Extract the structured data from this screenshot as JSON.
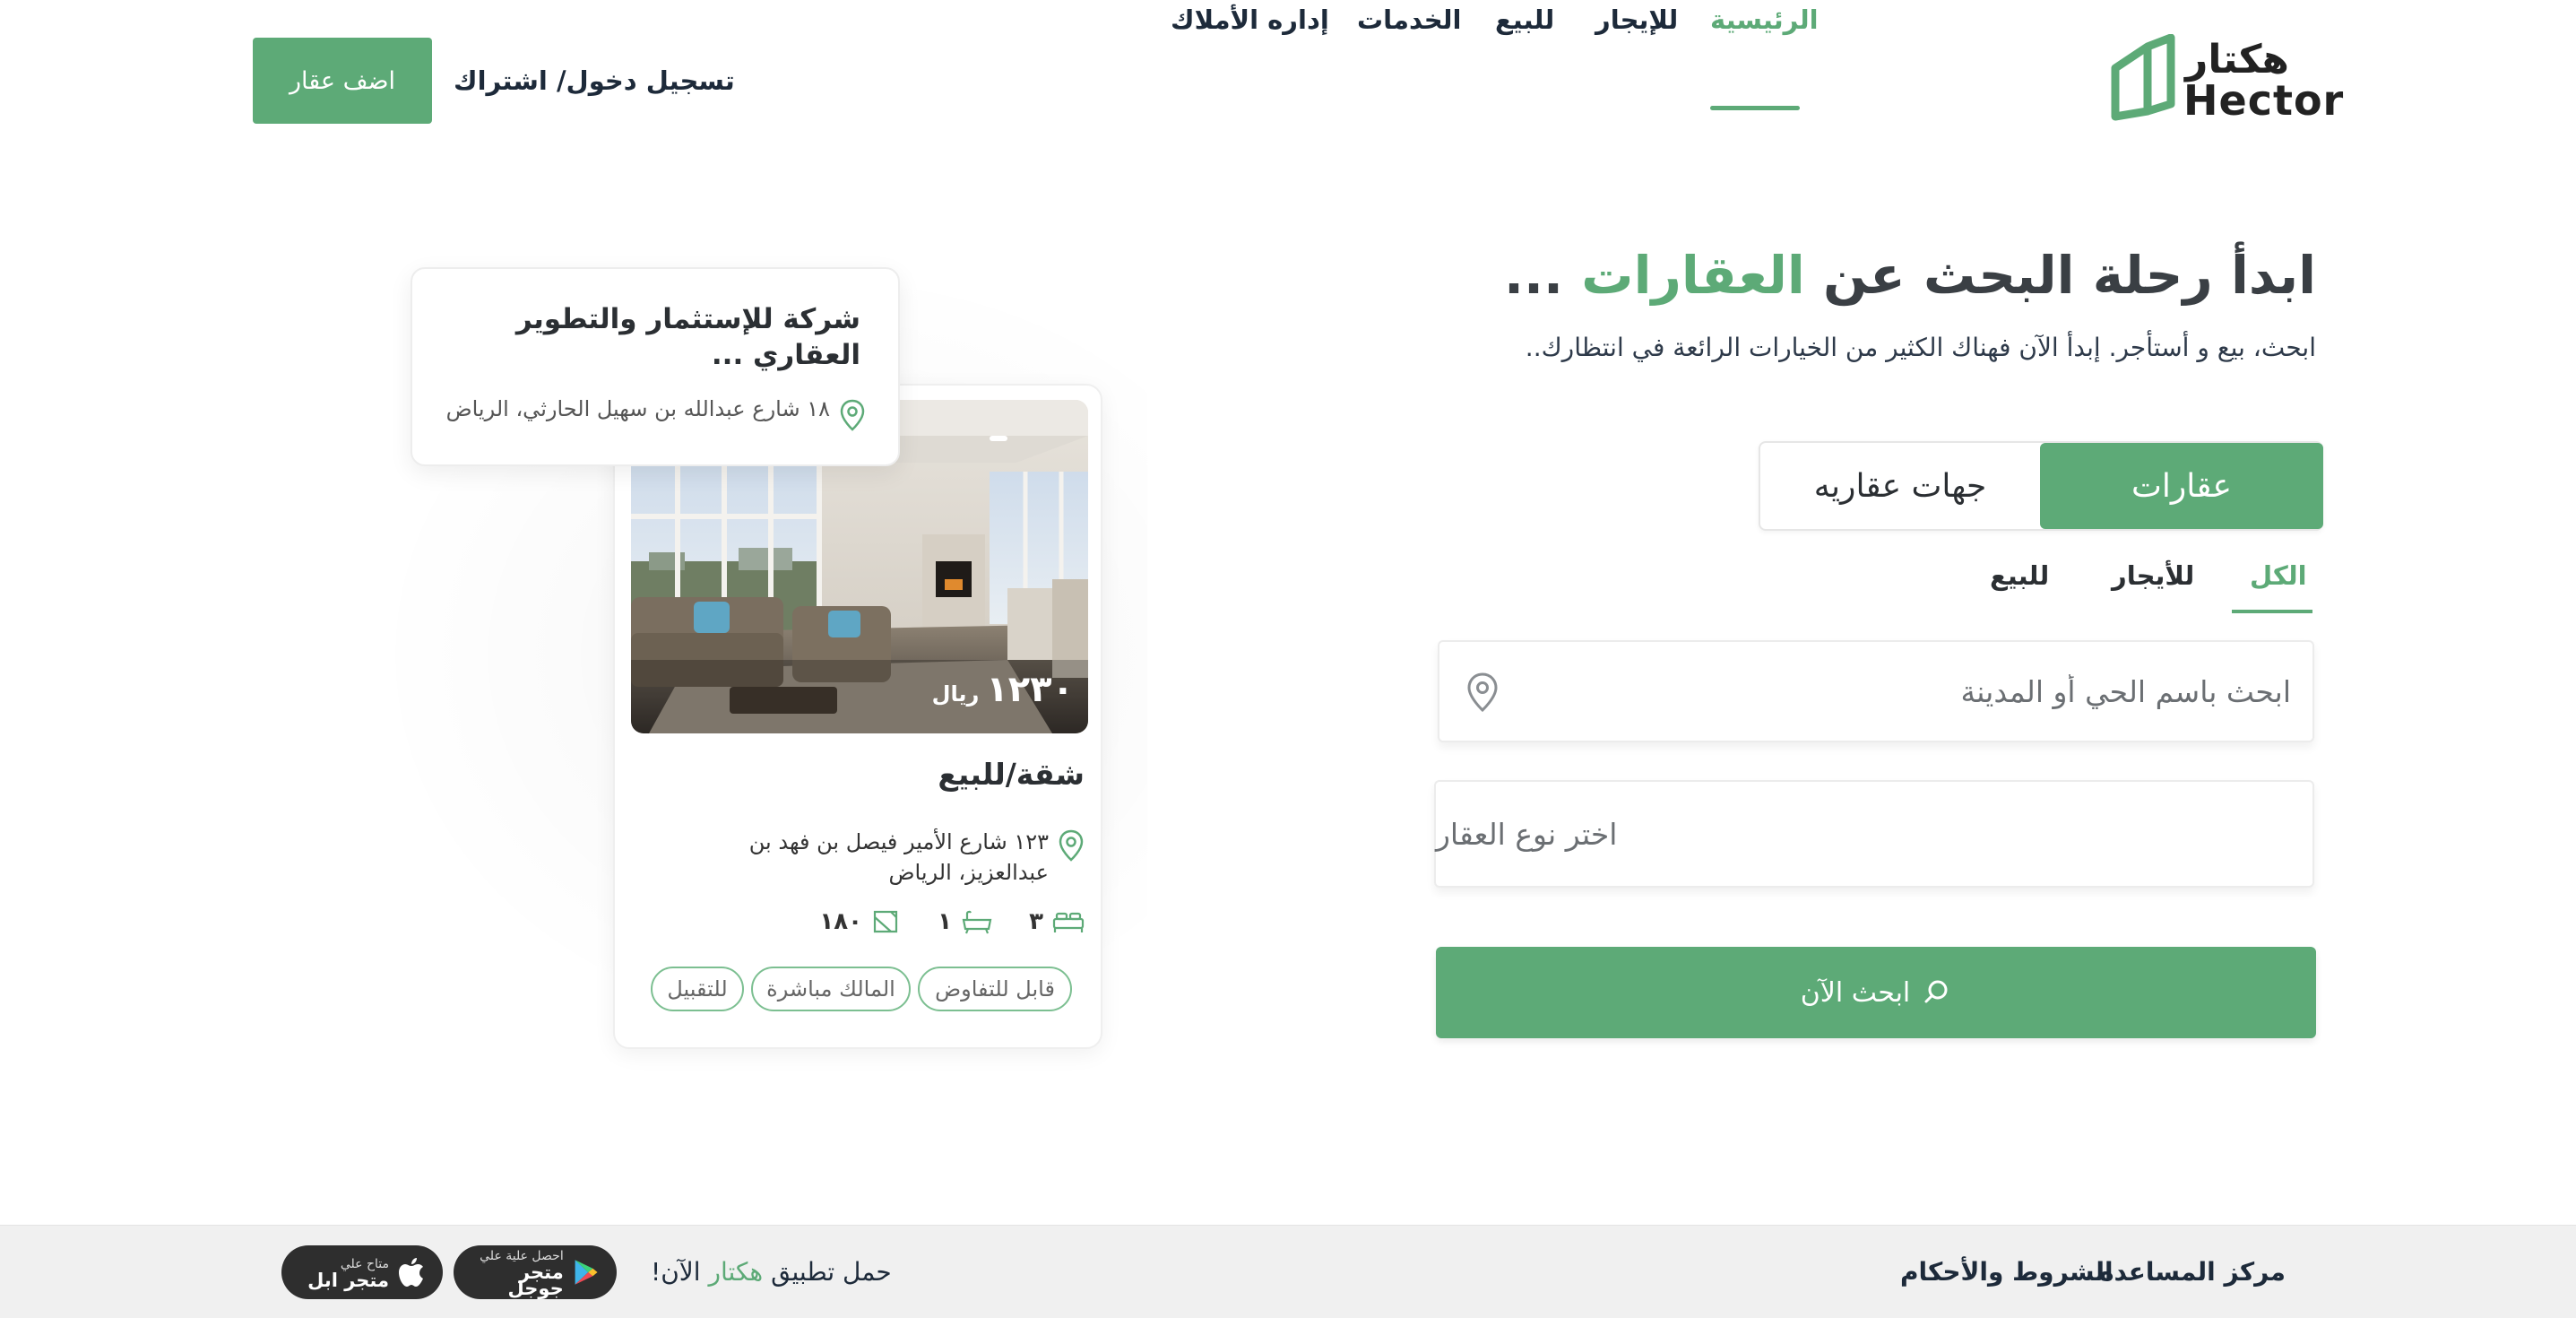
{
  "brand": {
    "name_ar": "هكتار",
    "name_en": "Hector",
    "color": "#5daa77"
  },
  "nav": {
    "home": "الرئيسية",
    "rent": "للإيجار",
    "sale": "للبيع",
    "services": "الخدمات",
    "property_mgmt": "إداره الأملاك"
  },
  "header": {
    "login": "تسجيل دخول/ اشتراك",
    "add_property": "اضف عقار"
  },
  "hero": {
    "title_part1": "ابدأ رحلة البحث عن",
    "title_accent": "العقارات",
    "title_part2": "...",
    "subtitle": "ابحث، بيع و أستأجر. إبدأ الآن فهناك الكثير من الخيارات الرائعة في انتظارك.."
  },
  "search": {
    "type_tabs": {
      "properties": "عقارات",
      "agencies": "جهات عقاريه"
    },
    "filters": {
      "all": "الكل",
      "rent": "للأيجار",
      "sale": "للبيع"
    },
    "location_placeholder": "ابحث باسم الحي أو المدينة",
    "property_type_placeholder": "اختر نوع العقار",
    "button": "ابحث الآن"
  },
  "company_card": {
    "name": "شركة للإستثمار والتطوير العقاري ...",
    "address": "١٨ شارع عبدالله بن سهيل الحارثي، الرياض"
  },
  "listing_card": {
    "price": "١٢٣٠",
    "currency": "ريال",
    "title": "شقة/للبيع",
    "address": "١٢٣ شارع الأمير فيصل بن فهد بن عبدالعزيز، الرياض",
    "bedrooms": "٣",
    "bathrooms": "١",
    "area": "١٨٠",
    "tags": [
      "قابل للتفاوض",
      "المالك مباشرة",
      "للتقبيل"
    ]
  },
  "footer": {
    "help_center": "مركز المساعده",
    "terms": "الشروط والأحكام",
    "app_text_before": "حمل تطبيق",
    "app_text_brand": "هكتار",
    "app_text_after": "الآن!",
    "google_small": "احصل علية علي",
    "google_big": "متجر جوجل",
    "apple_small": "متاح علي",
    "apple_big": "متجر ابل"
  }
}
